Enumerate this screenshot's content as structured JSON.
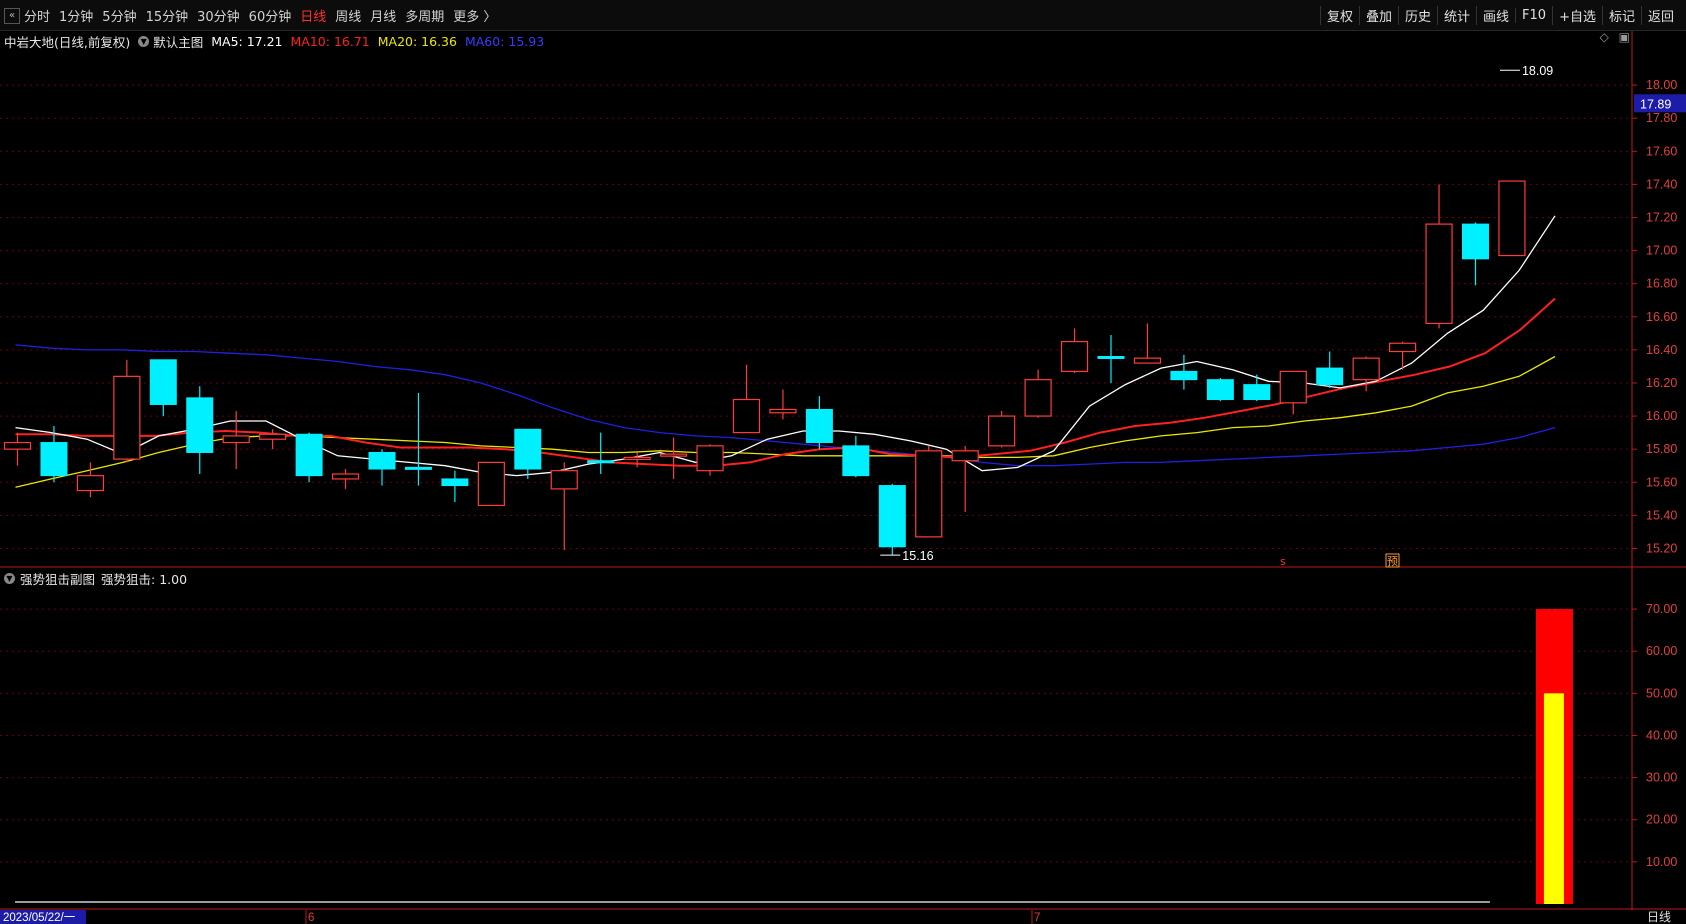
{
  "toolbar": {
    "periods": [
      "分时",
      "1分钟",
      "5分钟",
      "15分钟",
      "30分钟",
      "60分钟",
      "日线",
      "周线",
      "月线",
      "多周期",
      "更多 〉"
    ],
    "active_period": "日线",
    "tools": [
      "复权",
      "叠加",
      "历史",
      "统计",
      "画线",
      "F10",
      "+自选",
      "标记",
      "返回"
    ]
  },
  "main_header": {
    "stock": "中岩大地(日线,前复权)",
    "template": "默认主图",
    "ma5": "MA5: 17.21",
    "ma10": "MA10: 16.71",
    "ma20": "MA20: 16.36",
    "ma60": "MA60: 15.93"
  },
  "sub_header": {
    "name": "强势狙击副图",
    "value": "强势狙击: 1.00"
  },
  "current_price_tag": "17.89",
  "markers": {
    "s_label": "s",
    "yu_label": "预"
  },
  "bottom_axis": {
    "date_label": "2023/05/22/一",
    "month1": "6",
    "month2": "7",
    "period": "日线"
  },
  "colors": {
    "up": "#ff3b3b",
    "down": "#00f0ff",
    "ma5": "#ffffff",
    "ma10": "#ff2020",
    "ma20": "#e8e800",
    "ma60": "#2020e0",
    "grid": "#6a0000",
    "axis": "#c01818"
  },
  "chart_data": [
    {
      "type": "candlestick",
      "title": "中岩大地(日线,前复权)",
      "ylim": [
        15.1,
        18.2
      ],
      "yticks": [
        15.2,
        15.4,
        15.6,
        15.8,
        16.0,
        16.2,
        16.4,
        16.6,
        16.8,
        17.0,
        17.2,
        17.4,
        17.6,
        17.8,
        18.0
      ],
      "ytick_labels": [
        "15.20",
        "15.40",
        "15.60",
        "15.80",
        "16.00",
        "16.20",
        "16.40",
        "16.60",
        "16.80",
        "17.00",
        "17.20",
        "17.40",
        "17.60",
        "17.80",
        "18.00"
      ],
      "candles": [
        {
          "o": 15.8,
          "h": 15.9,
          "l": 15.7,
          "c": 15.84
        },
        {
          "o": 15.84,
          "h": 15.94,
          "l": 15.6,
          "c": 15.64
        },
        {
          "o": 15.55,
          "h": 15.72,
          "l": 15.51,
          "c": 15.64
        },
        {
          "o": 15.74,
          "h": 16.34,
          "l": 15.72,
          "c": 16.24
        },
        {
          "o": 16.34,
          "h": 16.34,
          "l": 16.0,
          "c": 16.07
        },
        {
          "o": 16.11,
          "h": 16.18,
          "l": 15.65,
          "c": 15.78
        },
        {
          "o": 15.84,
          "h": 16.03,
          "l": 15.68,
          "c": 15.88
        },
        {
          "o": 15.86,
          "h": 15.92,
          "l": 15.8,
          "c": 15.89
        },
        {
          "o": 15.89,
          "h": 15.9,
          "l": 15.6,
          "c": 15.64
        },
        {
          "o": 15.62,
          "h": 15.68,
          "l": 15.56,
          "c": 15.65
        },
        {
          "o": 15.78,
          "h": 15.8,
          "l": 15.58,
          "c": 15.68
        },
        {
          "o": 15.69,
          "h": 16.14,
          "l": 15.58,
          "c": 15.68
        },
        {
          "o": 15.62,
          "h": 15.67,
          "l": 15.48,
          "c": 15.58
        },
        {
          "o": 15.46,
          "h": 15.72,
          "l": 15.46,
          "c": 15.72
        },
        {
          "o": 15.92,
          "h": 15.92,
          "l": 15.62,
          "c": 15.68
        },
        {
          "o": 15.56,
          "h": 15.72,
          "l": 15.19,
          "c": 15.67
        },
        {
          "o": 15.73,
          "h": 15.9,
          "l": 15.65,
          "c": 15.72
        },
        {
          "o": 15.74,
          "h": 15.78,
          "l": 15.69,
          "c": 15.75
        },
        {
          "o": 15.77,
          "h": 15.87,
          "l": 15.62,
          "c": 15.77
        },
        {
          "o": 15.67,
          "h": 15.83,
          "l": 15.64,
          "c": 15.82
        },
        {
          "o": 15.9,
          "h": 16.31,
          "l": 15.9,
          "c": 16.1
        },
        {
          "o": 16.02,
          "h": 16.16,
          "l": 15.98,
          "c": 16.04
        },
        {
          "o": 16.04,
          "h": 16.12,
          "l": 15.8,
          "c": 15.84
        },
        {
          "o": 15.82,
          "h": 15.88,
          "l": 15.63,
          "c": 15.64
        },
        {
          "o": 15.58,
          "h": 15.59,
          "l": 15.16,
          "c": 15.21
        },
        {
          "o": 15.27,
          "h": 15.82,
          "l": 15.27,
          "c": 15.79
        },
        {
          "o": 15.73,
          "h": 15.82,
          "l": 15.42,
          "c": 15.79
        },
        {
          "o": 15.82,
          "h": 16.03,
          "l": 15.81,
          "c": 16.0
        },
        {
          "o": 16.0,
          "h": 16.28,
          "l": 15.99,
          "c": 16.22
        },
        {
          "o": 16.27,
          "h": 16.53,
          "l": 16.26,
          "c": 16.45
        },
        {
          "o": 16.36,
          "h": 16.49,
          "l": 16.2,
          "c": 16.35
        },
        {
          "o": 16.32,
          "h": 16.56,
          "l": 16.32,
          "c": 16.35
        },
        {
          "o": 16.27,
          "h": 16.37,
          "l": 16.16,
          "c": 16.22
        },
        {
          "o": 16.22,
          "h": 16.23,
          "l": 16.09,
          "c": 16.1
        },
        {
          "o": 16.19,
          "h": 16.25,
          "l": 16.09,
          "c": 16.1
        },
        {
          "o": 16.08,
          "h": 16.27,
          "l": 16.01,
          "c": 16.27
        },
        {
          "o": 16.29,
          "h": 16.39,
          "l": 16.17,
          "c": 16.19
        },
        {
          "o": 16.22,
          "h": 16.36,
          "l": 16.15,
          "c": 16.35
        },
        {
          "o": 16.39,
          "h": 16.45,
          "l": 16.28,
          "c": 16.44
        },
        {
          "o": 16.56,
          "h": 17.4,
          "l": 16.53,
          "c": 17.16
        },
        {
          "o": 17.16,
          "h": 17.17,
          "l": 16.79,
          "c": 16.95
        },
        {
          "o": 16.97,
          "h": 17.42,
          "l": 16.97,
          "c": 17.42
        }
      ],
      "ma": [
        {
          "name": "MA5",
          "values": [
            15.93,
            15.9,
            15.86,
            15.77,
            15.88,
            15.92,
            15.97,
            15.97,
            15.86,
            15.76,
            15.74,
            15.72,
            15.7,
            15.66,
            15.64,
            15.66,
            15.71,
            15.74,
            15.78,
            15.72,
            15.76,
            15.86,
            15.91,
            15.91,
            15.89,
            15.85,
            15.8,
            15.67,
            15.69,
            15.79,
            16.06,
            16.19,
            16.29,
            16.33,
            16.28,
            16.21,
            16.2,
            16.17,
            16.21,
            16.32,
            16.5,
            16.64,
            16.88,
            17.21
          ]
        },
        {
          "name": "MA10",
          "values": [
            15.89,
            15.89,
            15.88,
            15.88,
            15.88,
            15.9,
            15.91,
            15.9,
            15.88,
            15.88,
            15.84,
            15.81,
            15.81,
            15.81,
            15.8,
            15.78,
            15.75,
            15.72,
            15.71,
            15.7,
            15.7,
            15.72,
            15.77,
            15.8,
            15.81,
            15.77,
            15.76,
            15.75,
            15.77,
            15.79,
            15.84,
            15.9,
            15.94,
            15.96,
            15.99,
            16.03,
            16.07,
            16.12,
            16.17,
            16.21,
            16.25,
            16.3,
            16.38,
            16.52,
            16.71
          ]
        },
        {
          "name": "MA20",
          "values": [
            15.57,
            15.62,
            15.67,
            15.72,
            15.78,
            15.83,
            15.87,
            15.88,
            15.88,
            15.87,
            15.86,
            15.85,
            15.84,
            15.82,
            15.81,
            15.8,
            15.78,
            15.78,
            15.79,
            15.78,
            15.78,
            15.77,
            15.76,
            15.76,
            15.76,
            15.76,
            15.76,
            15.75,
            15.75,
            15.76,
            15.81,
            15.85,
            15.88,
            15.9,
            15.93,
            15.94,
            15.97,
            15.99,
            16.02,
            16.06,
            16.14,
            16.18,
            16.24,
            16.36
          ]
        },
        {
          "name": "MA60",
          "values": [
            16.43,
            16.41,
            16.4,
            16.4,
            16.39,
            16.39,
            16.38,
            16.37,
            16.35,
            16.33,
            16.3,
            16.28,
            16.25,
            16.2,
            16.13,
            16.05,
            15.98,
            15.93,
            15.9,
            15.88,
            15.87,
            15.85,
            15.83,
            15.81,
            15.79,
            15.77,
            15.75,
            15.72,
            15.7,
            15.7,
            15.71,
            15.72,
            15.72,
            15.73,
            15.74,
            15.75,
            15.76,
            15.77,
            15.78,
            15.79,
            15.81,
            15.83,
            15.87,
            15.93
          ]
        }
      ],
      "annotations": [
        {
          "text": "18.09",
          "candle_index": 41,
          "value": 18.09
        },
        {
          "text": "15.16",
          "candle_index": 24,
          "value": 15.16
        }
      ]
    },
    {
      "type": "bar",
      "title": "强势狙击副图",
      "ylim": [
        0,
        75
      ],
      "yticks": [
        10,
        20,
        30,
        40,
        50,
        60,
        70
      ],
      "ytick_labels": [
        "10.00",
        "20.00",
        "30.00",
        "40.00",
        "50.00",
        "60.00",
        "70.00"
      ],
      "series": [
        {
          "name": "强势狙击",
          "values": [
            0,
            0,
            0,
            0,
            0,
            0,
            0,
            0,
            0,
            0,
            0,
            0,
            0,
            0,
            0,
            0,
            0,
            0,
            0,
            0,
            0,
            0,
            0,
            0,
            0,
            0,
            0,
            0,
            0,
            0,
            0,
            0,
            0,
            0,
            0,
            0,
            0,
            0,
            0,
            0,
            0,
            70
          ]
        },
        {
          "values": [
            0,
            0,
            0,
            0,
            0,
            0,
            0,
            0,
            0,
            0,
            0,
            0,
            0,
            0,
            0,
            0,
            0,
            0,
            0,
            0,
            0,
            0,
            0,
            0,
            0,
            0,
            0,
            0,
            0,
            0,
            0,
            0,
            0,
            0,
            0,
            0,
            0,
            0,
            0,
            0,
            0,
            50
          ]
        }
      ]
    }
  ]
}
